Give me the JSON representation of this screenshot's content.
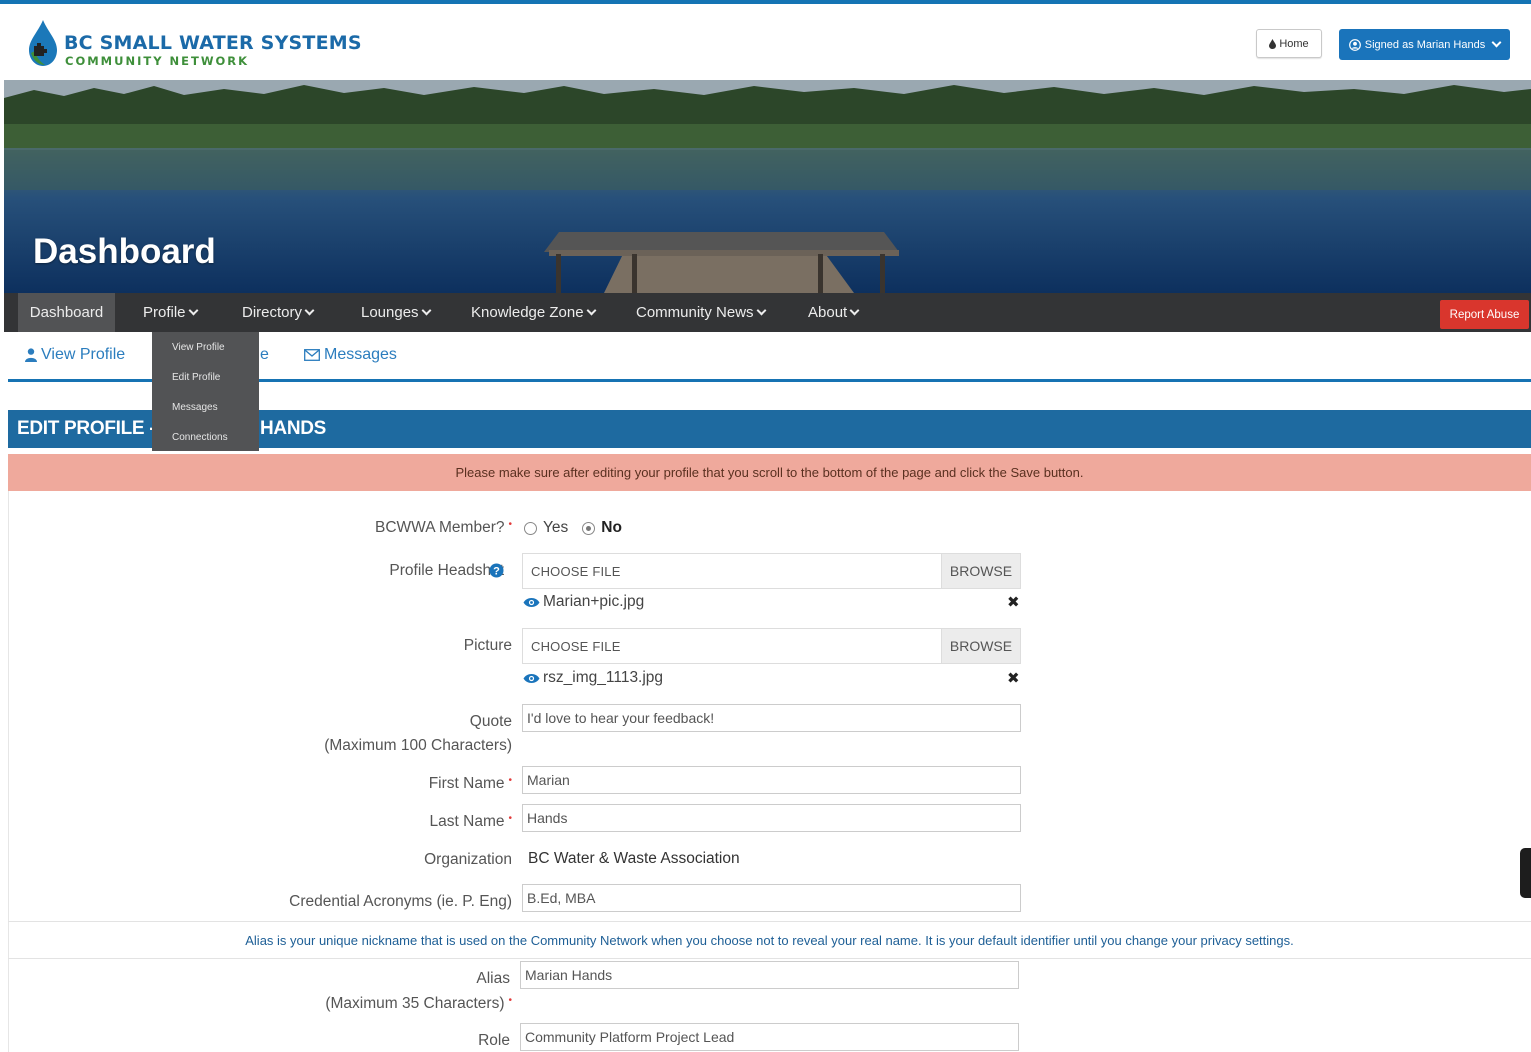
{
  "header": {
    "logo_title": "BC SMALL WATER SYSTEMS",
    "logo_subtitle": "COMMUNITY NETWORK",
    "home_label": "Home",
    "signed_label": "Signed as Marian Hands"
  },
  "banner": {
    "title": "Dashboard"
  },
  "nav": {
    "items": [
      {
        "label": "Dashboard"
      },
      {
        "label": "Profile"
      },
      {
        "label": "Directory"
      },
      {
        "label": "Lounges"
      },
      {
        "label": "Knowledge Zone"
      },
      {
        "label": "Community News"
      },
      {
        "label": "About"
      }
    ],
    "report_label": "Report Abuse"
  },
  "profile_menu": {
    "items": [
      "View Profile",
      "Edit Profile",
      "Messages",
      "Connections"
    ]
  },
  "subnav": {
    "view_profile": "View Profile",
    "edit_profile_partial": "e",
    "messages": "Messages"
  },
  "section": {
    "title_left": "EDIT PROFILE -",
    "title_right": "HANDS"
  },
  "alert": "Please make sure after editing your profile that you scroll to the bottom of the page and click the Save button.",
  "form": {
    "member": {
      "label": "BCWWA Member?",
      "yes": "Yes",
      "no": "No",
      "selected": "No"
    },
    "headshot": {
      "label": "Profile Headshot",
      "choose": "CHOOSE FILE",
      "browse": "BROWSE",
      "file": "Marian+pic.jpg"
    },
    "picture": {
      "label": "Picture",
      "choose": "CHOOSE FILE",
      "browse": "BROWSE",
      "file": "rsz_img_1113.jpg"
    },
    "quote": {
      "label": "Quote",
      "hint": "(Maximum 100 Characters)",
      "value": "I'd love to hear your feedback!"
    },
    "first_name": {
      "label": "First Name",
      "value": "Marian"
    },
    "last_name": {
      "label": "Last Name",
      "value": "Hands"
    },
    "organization": {
      "label": "Organization",
      "value": "BC Water & Waste Association"
    },
    "credentials": {
      "label": "Credential Acronyms (ie. P. Eng)",
      "value": "B.Ed, MBA"
    },
    "alias_info": "Alias is your unique nickname that is used on the Community Network when you choose not to reveal your real name. It is your default identifier until you change your privacy settings.",
    "alias": {
      "label": "Alias",
      "hint": "(Maximum 35 Characters)",
      "value": "Marian Hands"
    },
    "role": {
      "label": "Role",
      "value": "Community Platform Project Lead"
    }
  },
  "colors": {
    "brand_blue": "#1a74bb",
    "nav_bg": "#333436",
    "alert_bg": "#efa99c",
    "report_red": "#d9362d"
  }
}
